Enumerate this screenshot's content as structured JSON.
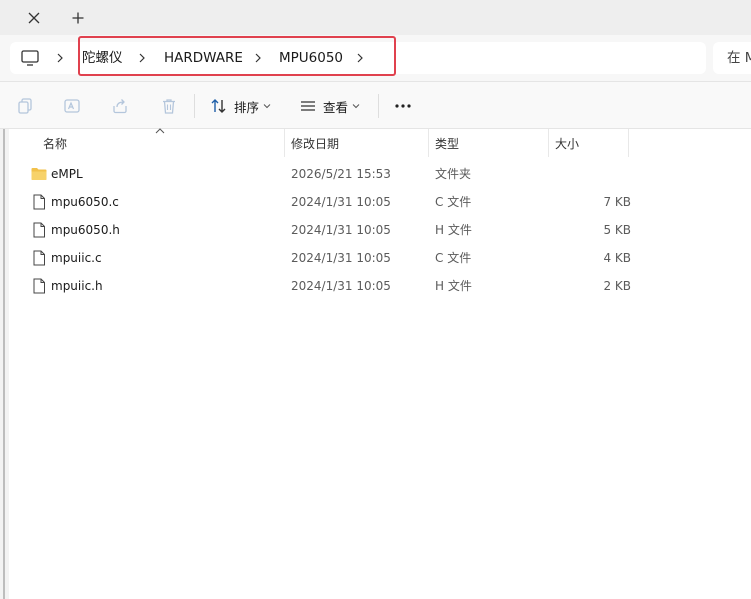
{
  "tabs": {
    "close_icon": "close-icon",
    "new_icon": "plus-icon"
  },
  "address": {
    "root_icon": "computer-icon",
    "crumbs": [
      "陀螺仪",
      "HARDWARE",
      "MPU6050"
    ],
    "search_placeholder": "在 M"
  },
  "toolbar": {
    "sort_label": "排序",
    "view_label": "查看",
    "more_label": "···"
  },
  "columns": {
    "name": "名称",
    "date": "修改日期",
    "type": "类型",
    "size": "大小"
  },
  "files": [
    {
      "name": "eMPL",
      "date": "2026/5/21 15:53",
      "type": "文件夹",
      "size": "",
      "icon": "folder-icon"
    },
    {
      "name": "mpu6050.c",
      "date": "2024/1/31 10:05",
      "type": "C 文件",
      "size": "7 KB",
      "icon": "file-icon"
    },
    {
      "name": "mpu6050.h",
      "date": "2024/1/31 10:05",
      "type": "H 文件",
      "size": "5 KB",
      "icon": "file-icon"
    },
    {
      "name": "mpuiic.c",
      "date": "2024/1/31 10:05",
      "type": "C 文件",
      "size": "4 KB",
      "icon": "file-icon"
    },
    {
      "name": "mpuiic.h",
      "date": "2024/1/31 10:05",
      "type": "H 文件",
      "size": "2 KB",
      "icon": "file-icon"
    }
  ],
  "colors": {
    "highlight": "#e0414e",
    "folder": "#f2c14b"
  }
}
